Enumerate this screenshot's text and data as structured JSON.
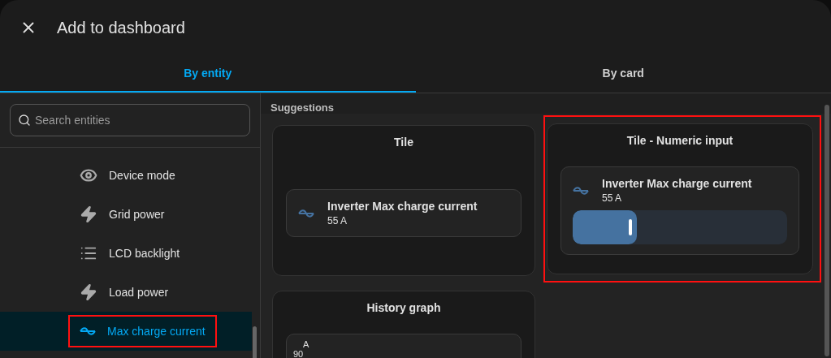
{
  "dialog": {
    "title": "Add to dashboard"
  },
  "tabs": [
    {
      "label": "By entity",
      "selected": true
    },
    {
      "label": "By card",
      "selected": false
    }
  ],
  "search": {
    "placeholder": "Search entities"
  },
  "entities": [
    {
      "name": "Device mode",
      "kind": "mode",
      "selected": false,
      "highlighted": false
    },
    {
      "name": "Grid power",
      "kind": "power",
      "selected": false,
      "highlighted": false
    },
    {
      "name": "LCD backlight",
      "kind": "setting",
      "selected": false,
      "highlighted": false
    },
    {
      "name": "Load power",
      "kind": "power",
      "selected": false,
      "highlighted": false
    },
    {
      "name": "Max charge current",
      "kind": "current",
      "selected": true,
      "highlighted": true
    }
  ],
  "suggestions": {
    "heading": "Suggestions",
    "cards": [
      {
        "title": "Tile",
        "kind": "tile",
        "highlighted": false,
        "entity": "Inverter Max charge current",
        "state": "55 A"
      },
      {
        "title": "Tile - Numeric input",
        "kind": "numeric",
        "highlighted": true,
        "entity": "Inverter Max charge current",
        "state": "55 A",
        "level": 0.3
      },
      {
        "title": "History graph",
        "kind": "history",
        "highlighted": false,
        "unit": "A",
        "tick": "90"
      }
    ]
  }
}
